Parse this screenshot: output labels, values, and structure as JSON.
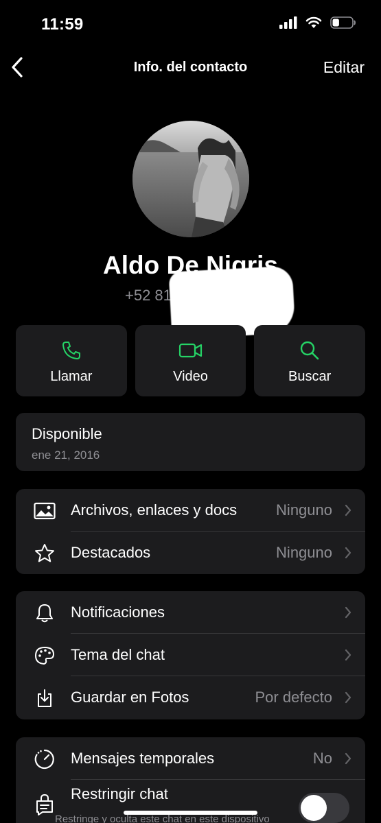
{
  "status_bar": {
    "time": "11:59",
    "battery_level": 0.35
  },
  "nav": {
    "back_icon": "chevron-left-icon",
    "title": "Info. del contacto",
    "edit_label": "Editar"
  },
  "contact": {
    "name": "Aldo De Nigris",
    "phone_visible": "+52 81"
  },
  "actions": [
    {
      "label": "Llamar",
      "icon": "phone-icon"
    },
    {
      "label": "Video",
      "icon": "video-icon"
    },
    {
      "label": "Buscar",
      "icon": "search-icon"
    }
  ],
  "about": {
    "status": "Disponible",
    "date": "ene 21, 2016"
  },
  "media_section": [
    {
      "label": "Archivos, enlaces y docs",
      "value": "Ninguno",
      "icon": "image-icon"
    },
    {
      "label": "Destacados",
      "value": "Ninguno",
      "icon": "star-icon"
    }
  ],
  "settings_section": [
    {
      "label": "Notificaciones",
      "value": "",
      "icon": "bell-icon"
    },
    {
      "label": "Tema del chat",
      "value": "",
      "icon": "palette-icon"
    },
    {
      "label": "Guardar en Fotos",
      "value": "Por defecto",
      "icon": "download-icon"
    }
  ],
  "privacy_section": {
    "temporal": {
      "label": "Mensajes temporales",
      "value": "No",
      "icon": "timer-icon"
    },
    "restrict": {
      "label": "Restringir chat",
      "subtitle": "Restringe y oculta este chat en este dispositivo",
      "icon": "lock-chat-icon",
      "enabled": false
    }
  },
  "colors": {
    "accent": "#25D366",
    "background": "#000000",
    "card": "#1c1c1e",
    "secondary_text": "#8e8e93"
  }
}
